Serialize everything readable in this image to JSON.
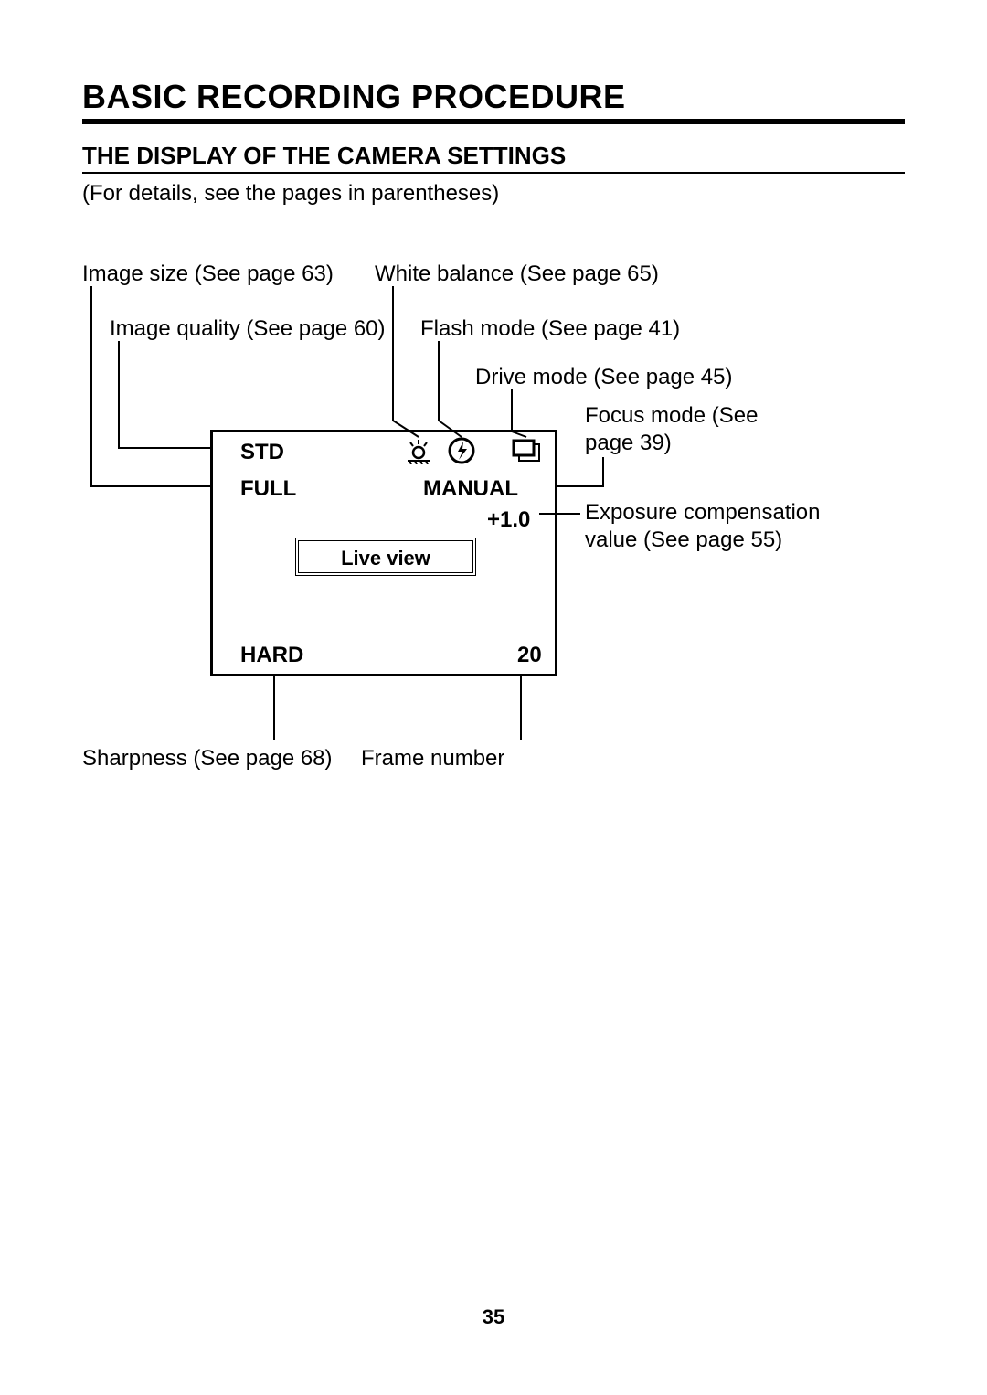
{
  "title": "BASIC RECORDING PROCEDURE",
  "subtitle": "THE DISPLAY OF THE CAMERA SETTINGS",
  "details_note": "(For details, see the pages in parentheses)",
  "page_number": "35",
  "labels": {
    "image_size": "Image size (See page 63)",
    "white_balance": "White balance (See page 65)",
    "image_quality": "Image quality (See page 60)",
    "flash_mode": "Flash mode (See page 41)",
    "drive_mode": "Drive mode (See page 45)",
    "focus_mode": "Focus mode (See page 39)",
    "exposure_comp": "Exposure compensation value (See page 55)",
    "sharpness": "Sharpness (See page 68)",
    "frame_number": "Frame number"
  },
  "display": {
    "std": "STD",
    "full": "FULL",
    "manual": "MANUAL",
    "ev": "+1.0",
    "live_view": "Live view",
    "hard": "HARD",
    "frame": "20"
  },
  "icons": {
    "white_balance": "white-balance-icon",
    "flash": "flash-icon",
    "drive": "drive-mode-icon"
  }
}
